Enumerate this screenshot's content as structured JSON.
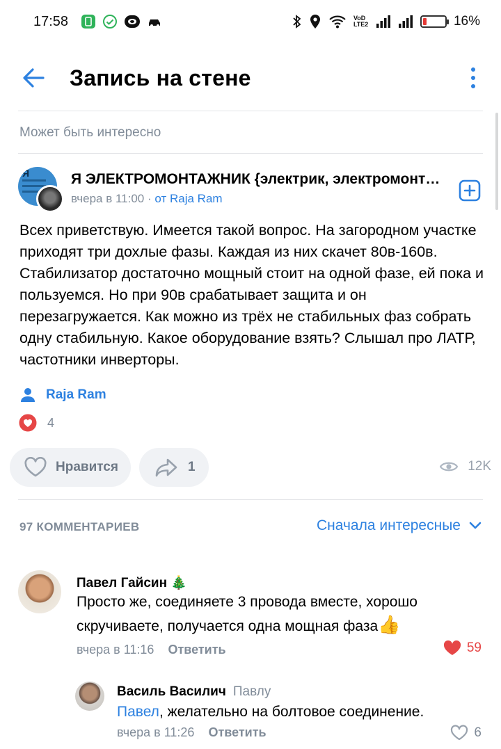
{
  "status_bar": {
    "time": "17:58",
    "network": "VoD LTE2",
    "battery": "16%",
    "battery_level": 0.16
  },
  "header": {
    "title": "Запись на стене"
  },
  "section_label": "Может быть интересно",
  "post": {
    "group_name": "Я ЭЛЕКТРОМОНТАЖНИК {электрик, электромонтаж}",
    "time": "вчера в 11:00",
    "from_prefix": "от",
    "from_author": "Raja Ram",
    "text": "Всех приветствую. Имеется такой вопрос. На загородном участке приходят три дохлые фазы. Каждая из них скачет 80в-160в. Стабилизатор достаточно мощный стоит на одной фазе, ей пока и пользуемся. Но при 90в срабатывает защита и он перезагружается. Как можно из трёх не стабильных фаз собрать одну стабильную. Какое оборудование взять? Слышал про ЛАТР, частотники инверторы.",
    "signer": "Raja Ram",
    "reactions_count": "4",
    "like_label": "Нравится",
    "shares_count": "1",
    "views": "12K"
  },
  "comments_header": {
    "count_label": "97 КОММЕНТАРИЕВ",
    "sort_label": "Сначала интересные"
  },
  "comments": [
    {
      "author": "Павел Гайсин",
      "badge": "🎄",
      "text": "Просто же, соединяете 3 провода вместе, хорошо скручиваете, получается одна мощная фаза",
      "emoji": "👍",
      "time": "вчера в 11:16",
      "reply_label": "Ответить",
      "likes": "59"
    },
    {
      "author": "Василь Василич",
      "reply_to": "Павлу",
      "mention": "Павел",
      "text": ", желательно на болтовое соединение.",
      "time": "вчера в 11:26",
      "reply_label": "Ответить",
      "likes": "6"
    }
  ],
  "colors": {
    "accent": "#2d81e0",
    "secondary_text": "#818c99",
    "like_red": "#e64646"
  }
}
